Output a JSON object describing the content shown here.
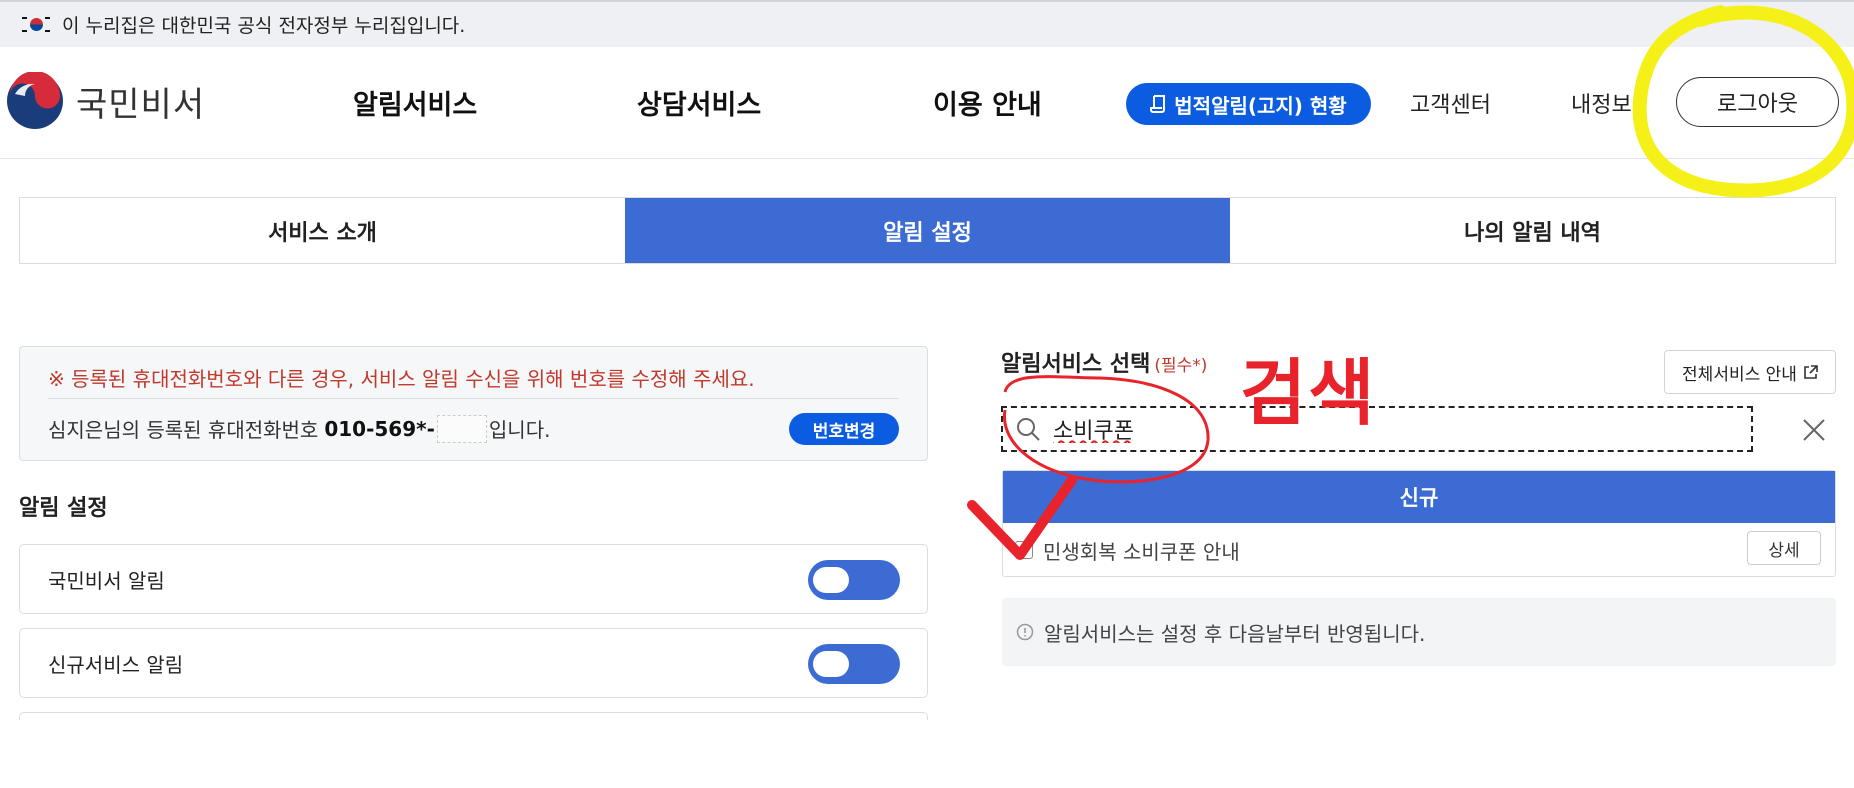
{
  "gov_banner": {
    "text": "이 누리집은 대한민국 공식 전자정부 누리집입니다."
  },
  "header": {
    "logo_text": "국민비서",
    "nav": [
      "알림서비스",
      "상담서비스",
      "이용 안내"
    ],
    "notice_button": "법적알림(고지) 현황",
    "customer_center": "고객센터",
    "my_info": "내정보",
    "logout": "로그아웃"
  },
  "tabs": [
    {
      "label": "서비스 소개",
      "active": false
    },
    {
      "label": "알림 설정",
      "active": true
    },
    {
      "label": "나의 알림 내역",
      "active": false
    }
  ],
  "phone": {
    "warning": "※ 등록된 휴대전화번호와 다른 경우, 서비스 알림 수신을 위해 번호를 수정해 주세요.",
    "prefix": "심지은님의 등록된 휴대전화번호",
    "number": "010-569*-",
    "suffix": "입니다.",
    "change_button": "번호변경"
  },
  "alarm_settings": {
    "title": "알림 설정",
    "items": [
      {
        "label": "국민비서 알림",
        "on": true
      },
      {
        "label": "신규서비스 알림",
        "on": true
      }
    ]
  },
  "service_select": {
    "label": "알림서비스 선택",
    "required": "(필수*)",
    "all_services_button": "전체서비스 안내",
    "search_value": "소비쿠폰",
    "result_header": "신규",
    "results": [
      {
        "label": "민생회복 소비쿠폰 안내",
        "detail_button": "상세"
      }
    ],
    "info": "알림서비스는 설정 후 다음날부터 반영됩니다."
  },
  "annotation": {
    "text": "검색",
    "color": "#e8232b",
    "highlight_color": "#f5f017"
  },
  "colors": {
    "primary": "#0b5ce0",
    "tab_active": "#3d6bd4",
    "warning": "#c0392b"
  }
}
